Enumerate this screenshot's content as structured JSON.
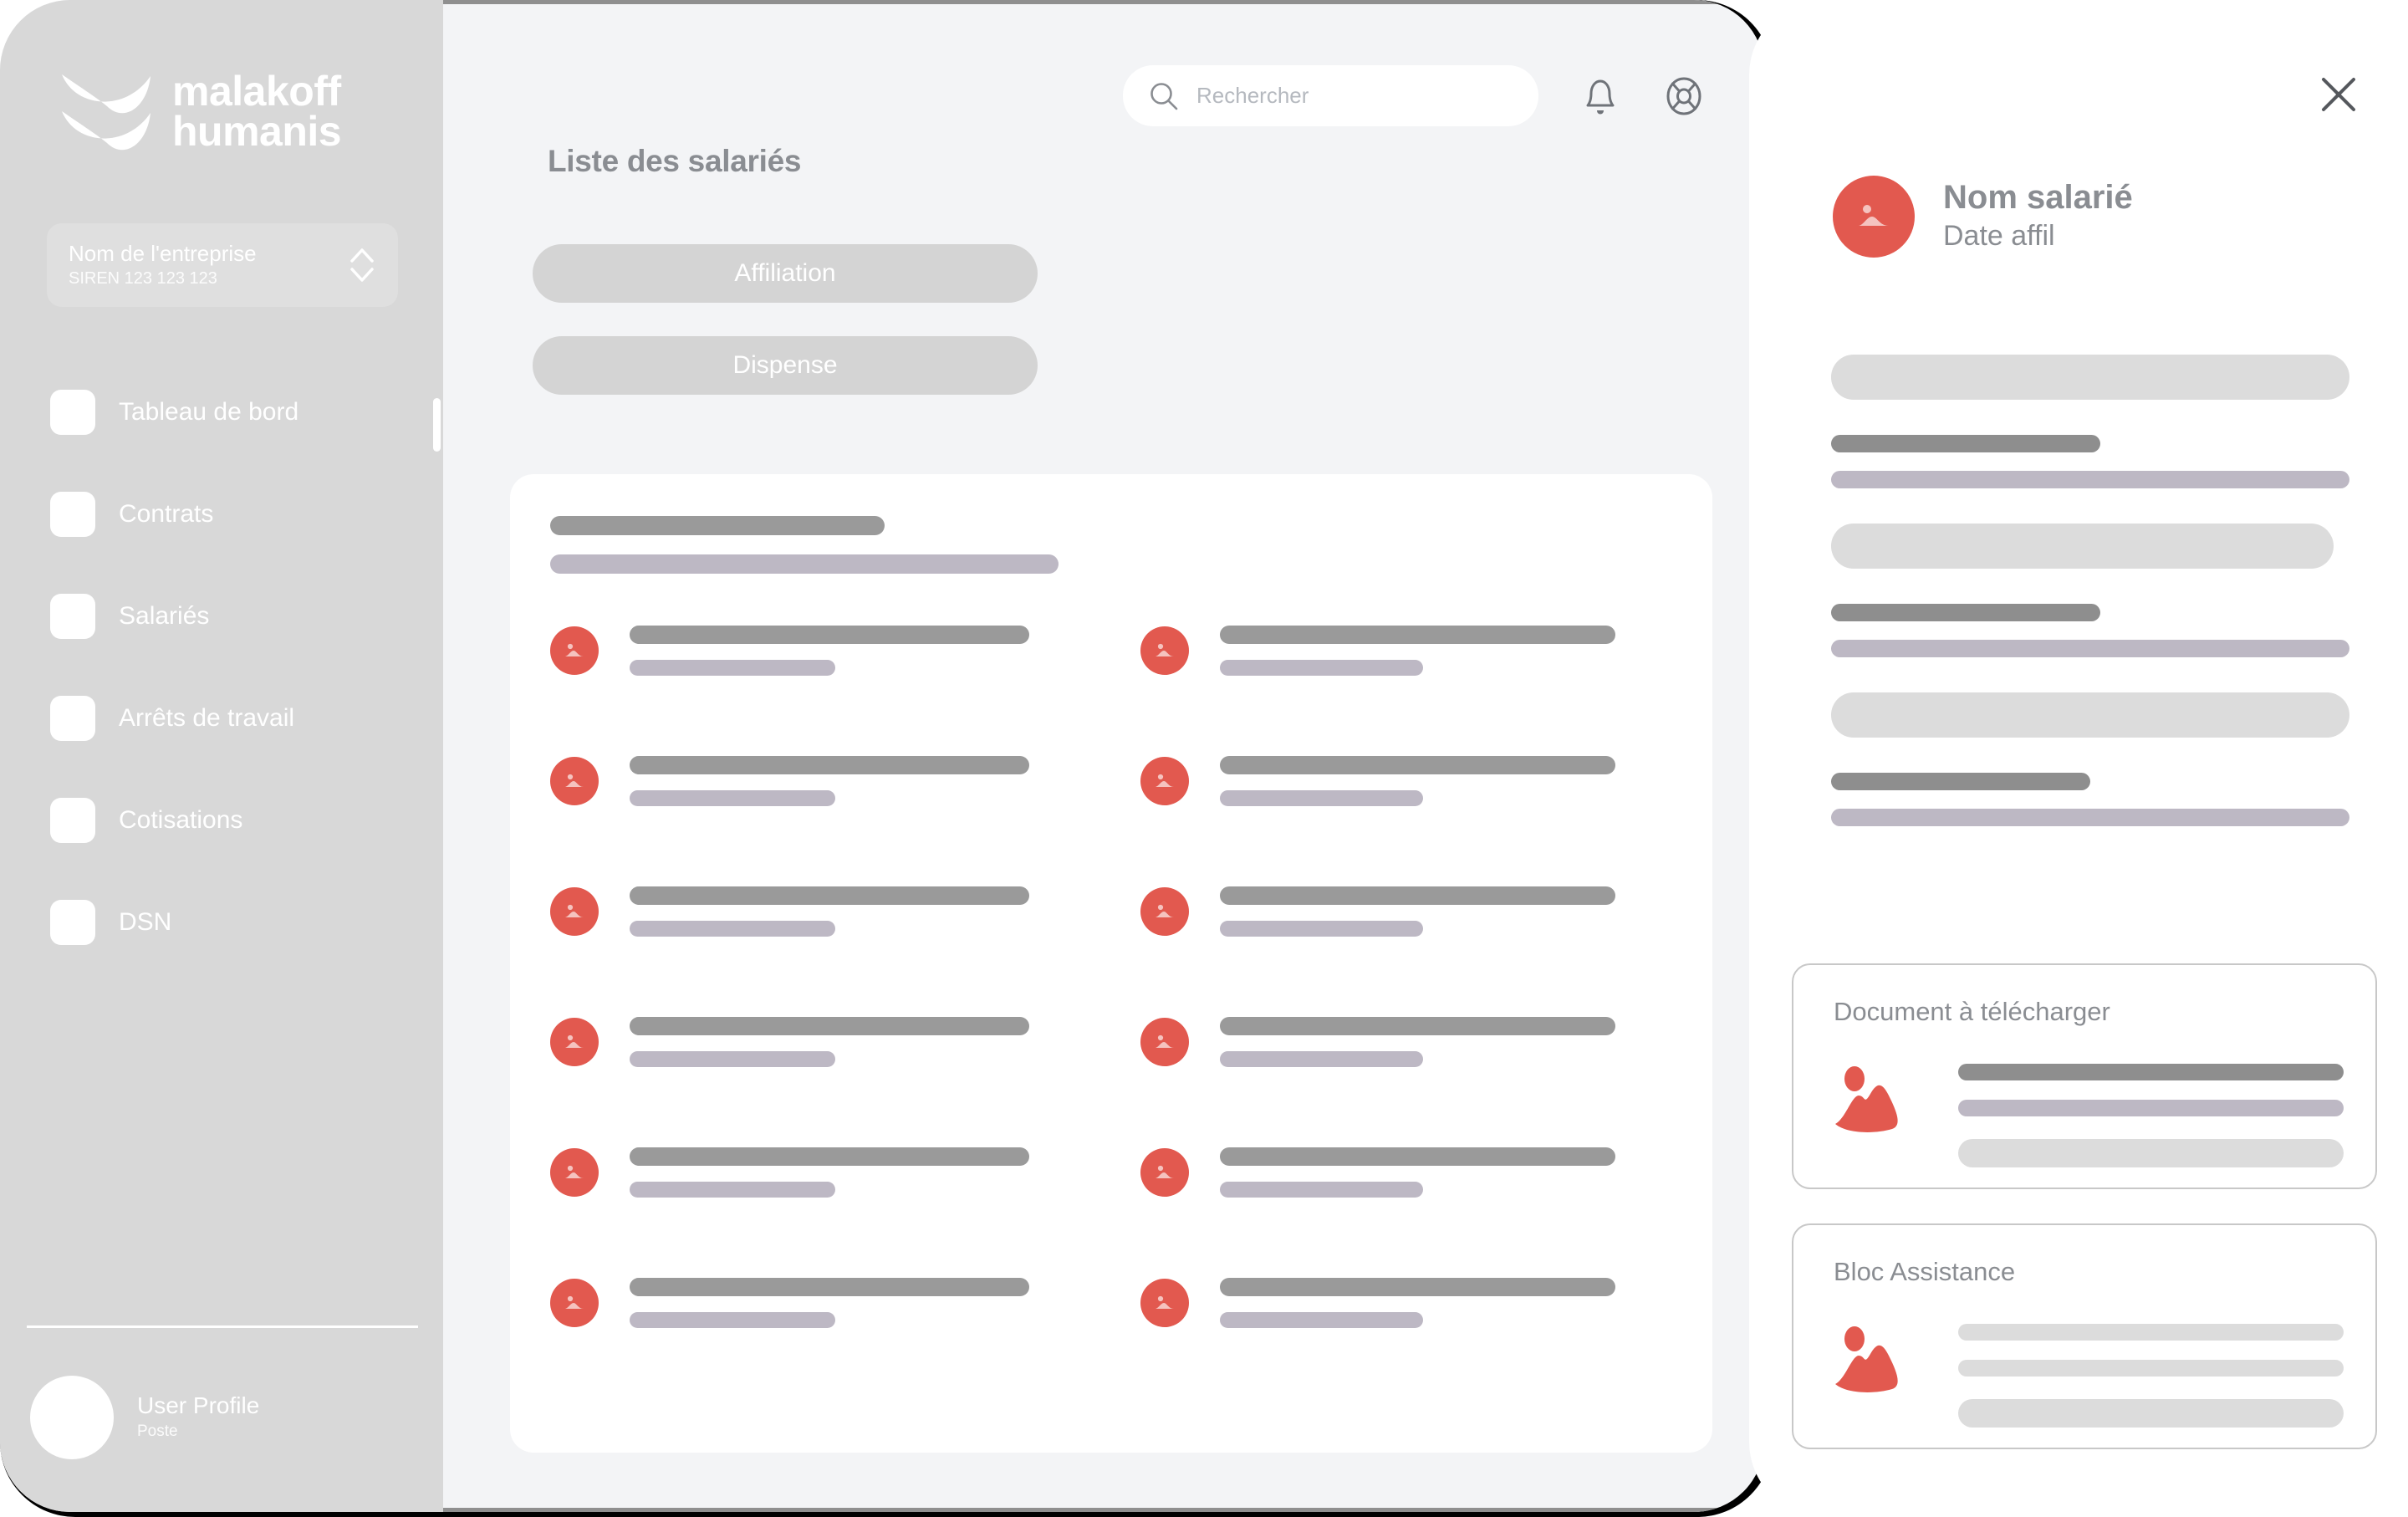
{
  "brand": {
    "logo_line1": "malakoff",
    "logo_line2": "humanis",
    "accent_color": "#e2594f",
    "sidebar_color": "#d8d8d8",
    "canvas_color": "#f3f4f6"
  },
  "sidebar": {
    "company": {
      "name": "Nom de l'entreprise",
      "siren": "SIREN 123 123 123",
      "switch_icon": "chevron-up-down-icon"
    },
    "items": [
      {
        "label": "Tableau de bord",
        "icon": "dashboard-icon"
      },
      {
        "label": "Contrats",
        "icon": "contract-icon"
      },
      {
        "label": "Salariés",
        "icon": "employees-icon"
      },
      {
        "label": "Arrêts de travail",
        "icon": "sick-leave-icon"
      },
      {
        "label": "Cotisations",
        "icon": "contributions-icon"
      },
      {
        "label": "DSN",
        "icon": "dsn-icon"
      }
    ],
    "user": {
      "name": "User Profile",
      "role": "Poste",
      "avatar_icon": "avatar-placeholder-icon"
    }
  },
  "topbar": {
    "search": {
      "placeholder": "Rechercher",
      "value": "",
      "icon": "search-icon"
    },
    "notifications_icon": "bell-icon",
    "support_icon": "lifebuoy-icon"
  },
  "main": {
    "title": "Liste des salariés",
    "tabs": [
      {
        "label": "Affiliation"
      },
      {
        "label": "Dispense"
      }
    ],
    "list": {
      "header_placeholder_widths": [
        400,
        608
      ],
      "row_count": 12,
      "rows_per_column": 6,
      "row_avatar_icon": "image-placeholder-icon"
    }
  },
  "detail_panel": {
    "close_icon": "close-icon",
    "employee": {
      "name": "Nom salarié",
      "subtitle": "Date affil",
      "avatar_icon": "image-placeholder-icon"
    },
    "skeleton_groups": [
      {
        "big_width_pct": 100,
        "dark_width_pct": 52,
        "lav_width_pct": 100
      },
      {
        "big_width_pct": 97,
        "dark_width_pct": 52,
        "lav_width_pct": 100
      },
      {
        "big_width_pct": 100,
        "dark_width_pct": 50,
        "lav_width_pct": 100
      }
    ],
    "cards": [
      {
        "title": "Document à télécharger",
        "illustration_icon": "image-placeholder-icon",
        "lines": [
          {
            "width_pct": 50,
            "color": "#8e8e8e"
          },
          {
            "width_pct": 50,
            "color": "#bdb8c4"
          },
          {
            "width_pct": 50,
            "color": "#dcdcdc"
          }
        ]
      },
      {
        "title": "Bloc Assistance",
        "illustration_icon": "image-placeholder-icon",
        "lines": [
          {
            "width_pct": 50,
            "color": "#dcdcdc"
          },
          {
            "width_pct": 50,
            "color": "#dcdcdc"
          },
          {
            "width_pct": 50,
            "color": "#dcdcdc"
          }
        ]
      }
    ]
  }
}
